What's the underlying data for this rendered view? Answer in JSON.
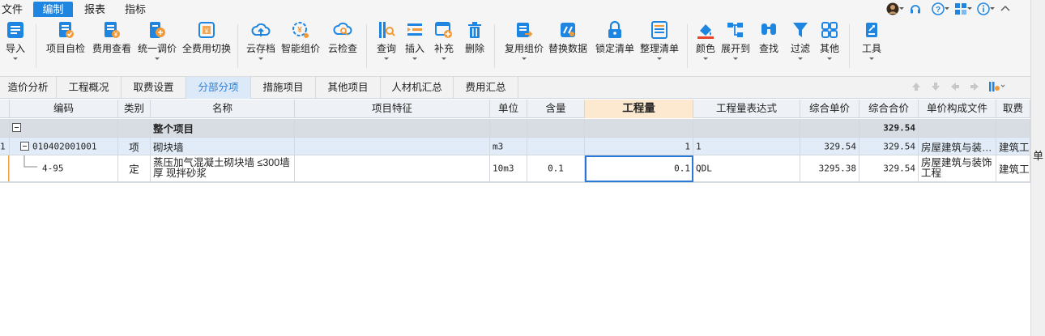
{
  "menubar": {
    "items": [
      "文件",
      "编制",
      "报表",
      "指标"
    ],
    "active": "编制",
    "file_arrow": "▾"
  },
  "ribbon": {
    "buttons": [
      {
        "label": "导入",
        "icon": "import-icon",
        "dropdown": true
      },
      {
        "label": "项目自检",
        "icon": "project-check-icon"
      },
      {
        "label": "费用查看",
        "icon": "fee-view-icon"
      },
      {
        "label": "统一调价",
        "icon": "adjust-price-icon",
        "dropdown": true
      },
      {
        "label": "全费用切换",
        "icon": "full-cost-switch-icon"
      },
      {
        "label": "云存档",
        "icon": "cloud-archive-icon",
        "dropdown": true
      },
      {
        "label": "智能组价",
        "icon": "smart-pricing-icon"
      },
      {
        "label": "云检查",
        "icon": "cloud-check-icon"
      },
      {
        "label": "查询",
        "icon": "query-icon",
        "dropdown": true
      },
      {
        "label": "插入",
        "icon": "insert-icon",
        "dropdown": true
      },
      {
        "label": "补充",
        "icon": "supplement-icon",
        "dropdown": true
      },
      {
        "label": "删除",
        "icon": "delete-icon"
      },
      {
        "label": "复用组价",
        "icon": "reuse-pricing-icon",
        "dropdown": true
      },
      {
        "label": "替换数据",
        "icon": "replace-data-icon"
      },
      {
        "label": "锁定清单",
        "icon": "lock-list-icon"
      },
      {
        "label": "整理清单",
        "icon": "organize-list-icon",
        "dropdown": true
      },
      {
        "label": "颜色",
        "icon": "color-fill-icon",
        "dropdown": true
      },
      {
        "label": "展开到",
        "icon": "expand-to-icon",
        "dropdown": true
      },
      {
        "label": "查找",
        "icon": "find-icon"
      },
      {
        "label": "过滤",
        "icon": "filter-icon",
        "dropdown": true
      },
      {
        "label": "其他",
        "icon": "other-icon",
        "dropdown": true
      },
      {
        "label": "工具",
        "icon": "tools-icon",
        "dropdown": true
      }
    ]
  },
  "tabs": [
    "造价分析",
    "工程概况",
    "取费设置",
    "分部分项",
    "措施项目",
    "其他项目",
    "人材机汇总",
    "费用汇总"
  ],
  "active_tab": "分部分项",
  "table": {
    "headers": [
      "编码",
      "类别",
      "名称",
      "项目特征",
      "单位",
      "含量",
      "工程量",
      "工程量表达式",
      "综合单价",
      "综合合价",
      "单价构成文件",
      "取费"
    ],
    "highlighted_header": "工程量",
    "rows": {
      "total": {
        "name": "整个项目",
        "total_price": "329.54"
      },
      "item": {
        "index": "1",
        "code": "010402001001",
        "category": "项",
        "name": "砌块墙",
        "unit": "m3",
        "quantity": "1",
        "expression": "1",
        "unit_price": "329.54",
        "total_price": "329.54",
        "price_file": "房屋建筑与装…",
        "fee": "建筑工程"
      },
      "quota": {
        "code": "4-95",
        "category": "定",
        "name": "蒸压加气混凝土砌块墙 ≤300墙厚 现拌砂浆",
        "unit": "10m3",
        "content": "0.1",
        "quantity": "0.1",
        "expression": "QDL",
        "unit_price": "3295.38",
        "total_price": "329.54",
        "price_file": "房屋建筑与装饰工程",
        "fee": "建筑工程"
      }
    }
  },
  "side_panel": {
    "label": "单"
  },
  "colors": {
    "accent": "#1e86e0",
    "selected_row": "#e2ecf8",
    "header_highlight": "#fde9cf"
  }
}
